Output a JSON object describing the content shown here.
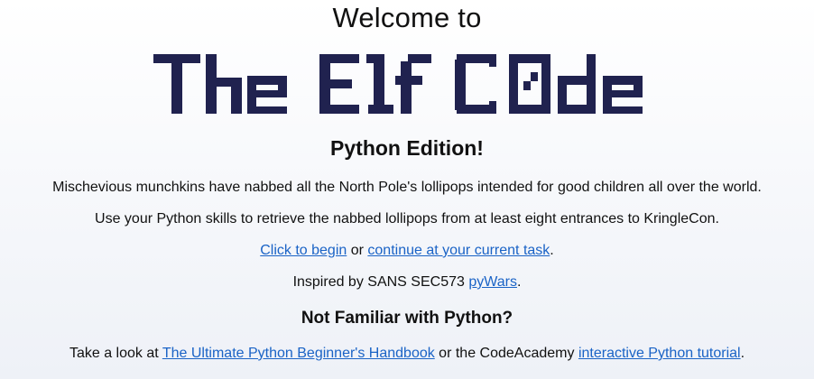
{
  "header": {
    "welcome": "Welcome to",
    "logo_text": "The Elf C0de",
    "edition": "Python Edition!"
  },
  "colors": {
    "logo": "#20224f",
    "link": "#1a63c6",
    "text": "#111111"
  },
  "intro": {
    "line1": "Mischevious munchkins have nabbed all the North Pole's lollipops intended for good children all over the world.",
    "line2": "Use your Python skills to retrieve the nabbed lollipops from at least eight entrances to KringleCon."
  },
  "actions": {
    "begin_link": "Click to begin",
    "or_text": " or ",
    "continue_link": "continue at your current task",
    "period": "."
  },
  "inspired": {
    "text": "Inspired by SANS SEC573 ",
    "link": "pyWars",
    "period": "."
  },
  "help": {
    "heading": "Not Familiar with Python?",
    "prefix": "Take a look at ",
    "handbook_link": "The Ultimate Python Beginner's Handbook",
    "middle": " or the CodeAcademy ",
    "tutorial_link": "interactive Python tutorial",
    "period": "."
  }
}
